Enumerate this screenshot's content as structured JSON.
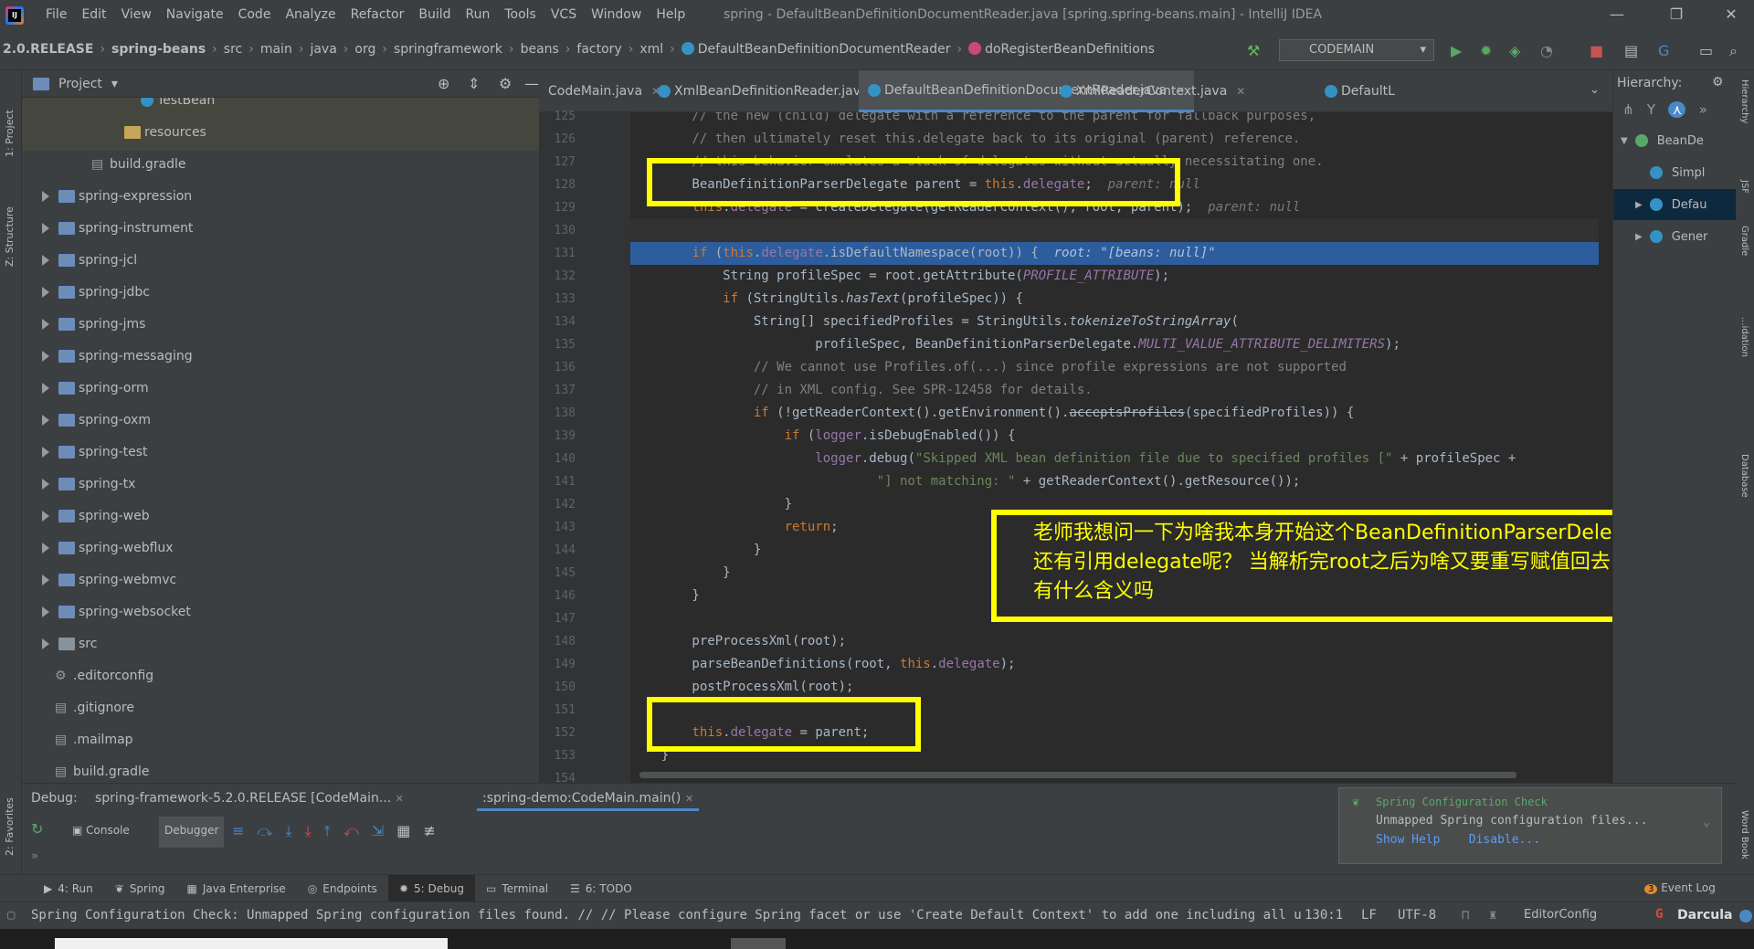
{
  "menu": [
    "File",
    "Edit",
    "View",
    "Navigate",
    "Code",
    "Analyze",
    "Refactor",
    "Build",
    "Run",
    "Tools",
    "VCS",
    "Window",
    "Help"
  ],
  "window_title": "spring - DefaultBeanDefinitionDocumentReader.java [spring.spring-beans.main] - IntelliJ IDEA",
  "breadcrumbs": [
    "2.0.RELEASE",
    "spring-beans",
    "src",
    "main",
    "java",
    "org",
    "springframework",
    "beans",
    "factory",
    "xml",
    "DefaultBeanDefinitionDocumentReader",
    "doRegisterBeanDefinitions"
  ],
  "run_config": "CODEMAIN",
  "project_panel": {
    "title": "Project",
    "items": [
      {
        "label": "TestBean",
        "indent": 130
      },
      {
        "label": "resources",
        "indent": 112
      },
      {
        "label": "build.gradle",
        "indent": 76
      },
      {
        "label": "spring-expression",
        "indent": 22
      },
      {
        "label": "spring-instrument",
        "indent": 22
      },
      {
        "label": "spring-jcl",
        "indent": 22
      },
      {
        "label": "spring-jdbc",
        "indent": 22
      },
      {
        "label": "spring-jms",
        "indent": 22
      },
      {
        "label": "spring-messaging",
        "indent": 22
      },
      {
        "label": "spring-orm",
        "indent": 22
      },
      {
        "label": "spring-oxm",
        "indent": 22
      },
      {
        "label": "spring-test",
        "indent": 22
      },
      {
        "label": "spring-tx",
        "indent": 22
      },
      {
        "label": "spring-web",
        "indent": 22
      },
      {
        "label": "spring-webflux",
        "indent": 22
      },
      {
        "label": "spring-webmvc",
        "indent": 22
      },
      {
        "label": "spring-websocket",
        "indent": 22
      },
      {
        "label": "src",
        "indent": 22
      },
      {
        "label": ".editorconfig",
        "indent": 36
      },
      {
        "label": ".gitignore",
        "indent": 36
      },
      {
        "label": ".mailmap",
        "indent": 36
      },
      {
        "label": "build.gradle",
        "indent": 36
      }
    ]
  },
  "tabs": [
    "CodeMain.java",
    "XmlBeanDefinitionReader.java",
    "DefaultBeanDefinitionDocumentReader.java",
    "XmlReaderContext.java",
    "DefaultL"
  ],
  "line_numbers": [
    "125",
    "126",
    "127",
    "128",
    "129",
    "130",
    "131",
    "132",
    "133",
    "134",
    "135",
    "136",
    "137",
    "138",
    "139",
    "140",
    "141",
    "142",
    "143",
    "144",
    "145",
    "146",
    "147",
    "148",
    "149",
    "150",
    "151",
    "152",
    "153",
    "154"
  ],
  "annotation": {
    "line1": "老师我想问一下为啥我本身开始这个BeanDefinitionParserDelegate为空",
    "line2": "还有引用delegate呢？ 当解析完root之后为啥又要重写赋值回去，",
    "line3": "有什么含义吗"
  },
  "hierarchy": {
    "title": "Hierarchy:",
    "items": [
      "BeanDe",
      "Simpl",
      "Defau",
      "Gener"
    ]
  },
  "debug": {
    "label": "Debug:",
    "session1": "spring-framework-5.2.0.RELEASE [CodeMain...",
    "session2": ":spring-demo:CodeMain.main()",
    "console": "Console",
    "debugger": "Debugger"
  },
  "popup": {
    "title": "Spring Configuration Check",
    "body": "Unmapped Spring configuration files...",
    "show_help": "Show Help",
    "disable": "Disable..."
  },
  "bottom_tabs": [
    "4: Run",
    "Spring",
    "Java Enterprise",
    "Endpoints",
    "5: Debug",
    "Terminal",
    "6: TODO"
  ],
  "event_log": "Event Log",
  "event_count": "3",
  "status": {
    "message": "Spring Configuration Check: Unmapped Spring configuration files found. // // Please configure Spring facet or use 'Create Default Context' to add one including all unmapped file... (t",
    "position": "130:1",
    "line_sep": "LF",
    "encoding": "UTF-8",
    "editorconfig": "EditorConfig",
    "theme": "Darcula"
  },
  "tool_labels": {
    "project": "1: Project",
    "structure": "Z: Structure",
    "favorites": "2: Favorites"
  }
}
